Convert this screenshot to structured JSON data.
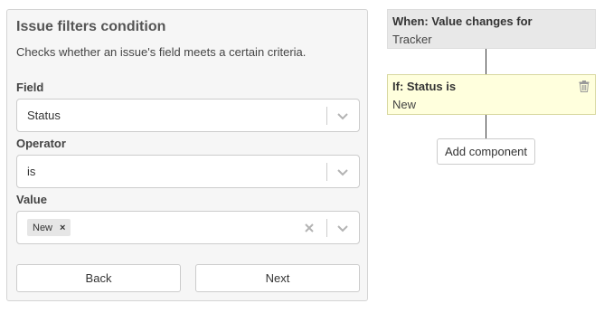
{
  "form": {
    "title": "Issue filters condition",
    "description": "Checks whether an issue's field meets a certain criteria.",
    "field": {
      "label": "Field",
      "value": "Status"
    },
    "operator": {
      "label": "Operator",
      "value": "is"
    },
    "value": {
      "label": "Value",
      "tags": [
        {
          "label": "New",
          "remove_icon": "×"
        }
      ]
    },
    "buttons": {
      "back": "Back",
      "next": "Next"
    }
  },
  "flow": {
    "when": {
      "title": "When: Value changes for",
      "subtitle": "Tracker"
    },
    "condition": {
      "title": "If: Status is",
      "subtitle": "New",
      "delete_icon": "trash-icon"
    },
    "add_component": "Add component"
  },
  "colors": {
    "panel_bg": "#f6f6f6",
    "when_bg": "#e8e8e8",
    "condition_bg": "#ffffdd",
    "condition_border": "#d8d8a0"
  }
}
